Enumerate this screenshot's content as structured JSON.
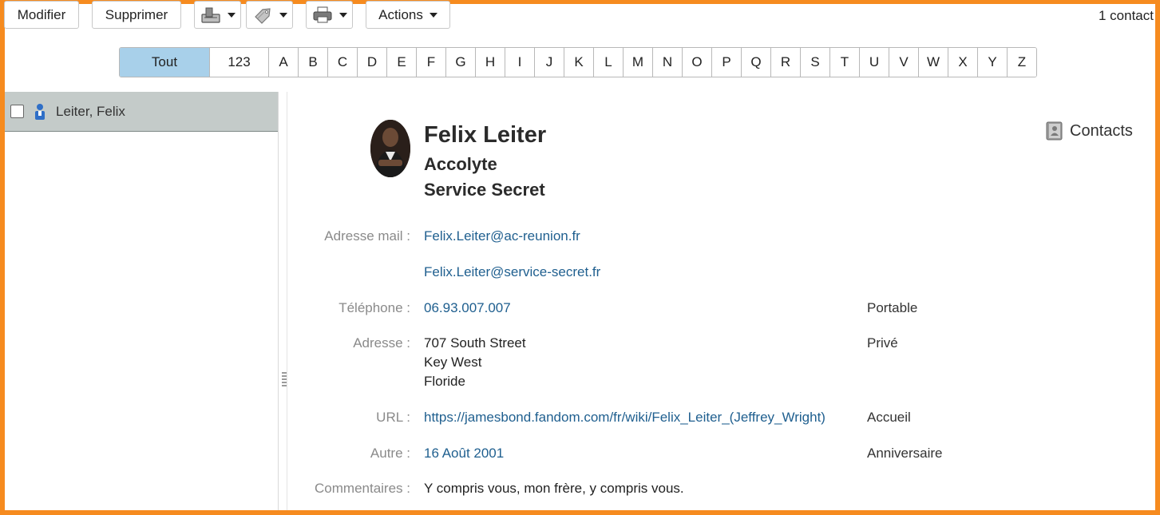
{
  "toolbar": {
    "modify_label": "Modifier",
    "delete_label": "Supprimer",
    "actions_label": "Actions",
    "contact_count": "1 contact"
  },
  "alphabet": [
    "Tout",
    "123",
    "A",
    "B",
    "C",
    "D",
    "E",
    "F",
    "G",
    "H",
    "I",
    "J",
    "K",
    "L",
    "M",
    "N",
    "O",
    "P",
    "Q",
    "R",
    "S",
    "T",
    "U",
    "V",
    "W",
    "X",
    "Y",
    "Z"
  ],
  "alphabet_selected": "Tout",
  "list": {
    "items": [
      {
        "label": "Leiter, Felix",
        "selected": true
      }
    ]
  },
  "contact": {
    "name": "Felix Leiter",
    "role": "Accolyte",
    "organization": "Service Secret",
    "address_book": "Contacts",
    "fields": {
      "email_label": "Adresse mail :",
      "email_1": "Felix.Leiter@ac-reunion.fr",
      "email_2": "Felix.Leiter@service-secret.fr",
      "phone_label": "Téléphone :",
      "phone": "06.93.007.007",
      "phone_type": "Portable",
      "address_label": "Adresse :",
      "address_line1": "707 South Street",
      "address_line2": "Key West",
      "address_line3": "Floride",
      "address_type": "Privé",
      "url_label": "URL :",
      "url": "https://jamesbond.fandom.com/fr/wiki/Felix_Leiter_(Jeffrey_Wright)",
      "url_type": "Accueil",
      "other_label": "Autre :",
      "other": "16 Août 2001",
      "other_type": "Anniversaire",
      "comments_label": "Commentaires :",
      "comments": "Y compris vous, mon frère, y compris vous."
    }
  },
  "colors": {
    "frame": "#f68b1f",
    "selected_letter": "#a8d0ea",
    "selected_row": "#c4cbc9",
    "link": "#1f5f8f"
  },
  "icons": {
    "import": "import-icon",
    "tag": "tag-icon",
    "print": "printer-icon",
    "person": "person-icon",
    "address_book": "address-book-icon"
  }
}
